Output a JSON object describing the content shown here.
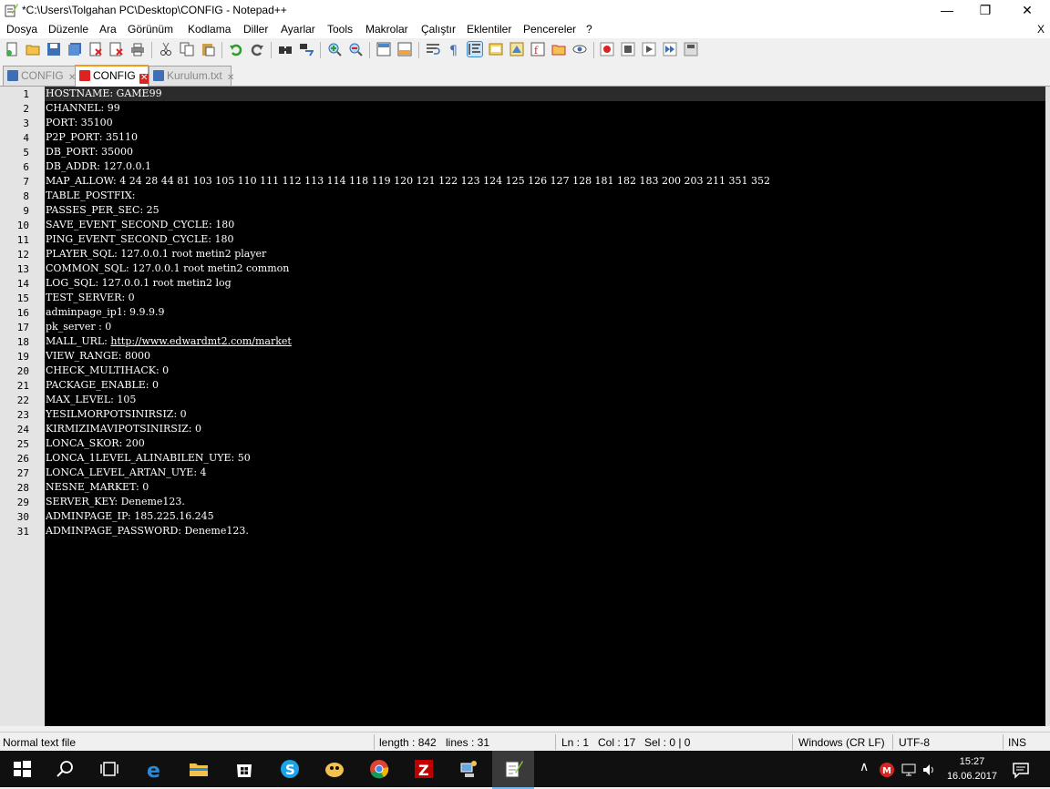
{
  "window": {
    "title": "*C:\\Users\\Tolgahan PC\\Desktop\\CONFIG - Notepad++"
  },
  "menu": [
    "Dosya",
    "Düzenle",
    "Ara",
    "Görünüm",
    "Kodlama",
    "Diller",
    "Ayarlar",
    "Tools",
    "Makrolar",
    "Çalıştır",
    "Eklentiler",
    "Pencereler",
    "?"
  ],
  "menu_close": "X",
  "tabs": [
    {
      "label": "CONFIG",
      "active": false
    },
    {
      "label": "CONFIG",
      "active": true
    },
    {
      "label": "Kurulum.txt",
      "active": false
    }
  ],
  "tab_close": "✕",
  "lines": [
    "HOSTNAME: GAME99",
    "CHANNEL: 99",
    "PORT: 35100",
    "P2P_PORT: 35110",
    "DB_PORT: 35000",
    "DB_ADDR: 127.0.0.1",
    "MAP_ALLOW: 4 24 28 44 81 103 105 110 111 112 113 114 118 119 120 121 122 123 124 125 126 127 128 181 182 183 200 203 211 351 352",
    "TABLE_POSTFIX:",
    "PASSES_PER_SEC: 25",
    "SAVE_EVENT_SECOND_CYCLE: 180",
    "PING_EVENT_SECOND_CYCLE: 180",
    "PLAYER_SQL: 127.0.0.1 root metin2 player",
    "COMMON_SQL: 127.0.0.1 root metin2 common",
    "LOG_SQL: 127.0.0.1 root metin2 log",
    "TEST_SERVER: 0",
    "adminpage_ip1: 9.9.9.9",
    "pk_server : 0",
    "MALL_URL: http://www.edwardmt2.com/market",
    "VIEW_RANGE: 8000",
    "CHECK_MULTIHACK: 0",
    "PACKAGE_ENABLE: 0",
    "MAX_LEVEL: 105",
    "YESILMORPOTSINIRSIZ: 0",
    "KIRMIZIMAVIPOTSINIRSIZ: 0",
    "LONCA_SKOR: 200",
    "LONCA_1LEVEL_ALINABILEN_UYE: 50",
    "LONCA_LEVEL_ARTAN_UYE: 4",
    "NESNE_MARKET: 0",
    "SERVER_KEY: Deneme123.",
    "ADMINPAGE_IP: 185.225.16.245",
    "ADMINPAGE_PASSWORD: Deneme123."
  ],
  "mall_url": {
    "prefix": "MALL_URL: ",
    "link": "http://www.edwardmt2.com/market"
  },
  "status": {
    "type": "Normal text file",
    "length": "length : 842",
    "lines": "lines : 31",
    "ln": "Ln : 1",
    "col": "Col : 17",
    "sel": "Sel : 0 | 0",
    "eol": "Windows (CR LF)",
    "encoding": "UTF-8",
    "mode": "INS"
  },
  "taskbar": {
    "time": "15:27",
    "date": "16.06.2017"
  },
  "icons": {
    "app": "notepad-plus-plus-icon",
    "saved_tab": "save-disk-icon",
    "tab_close": "close-icon"
  }
}
